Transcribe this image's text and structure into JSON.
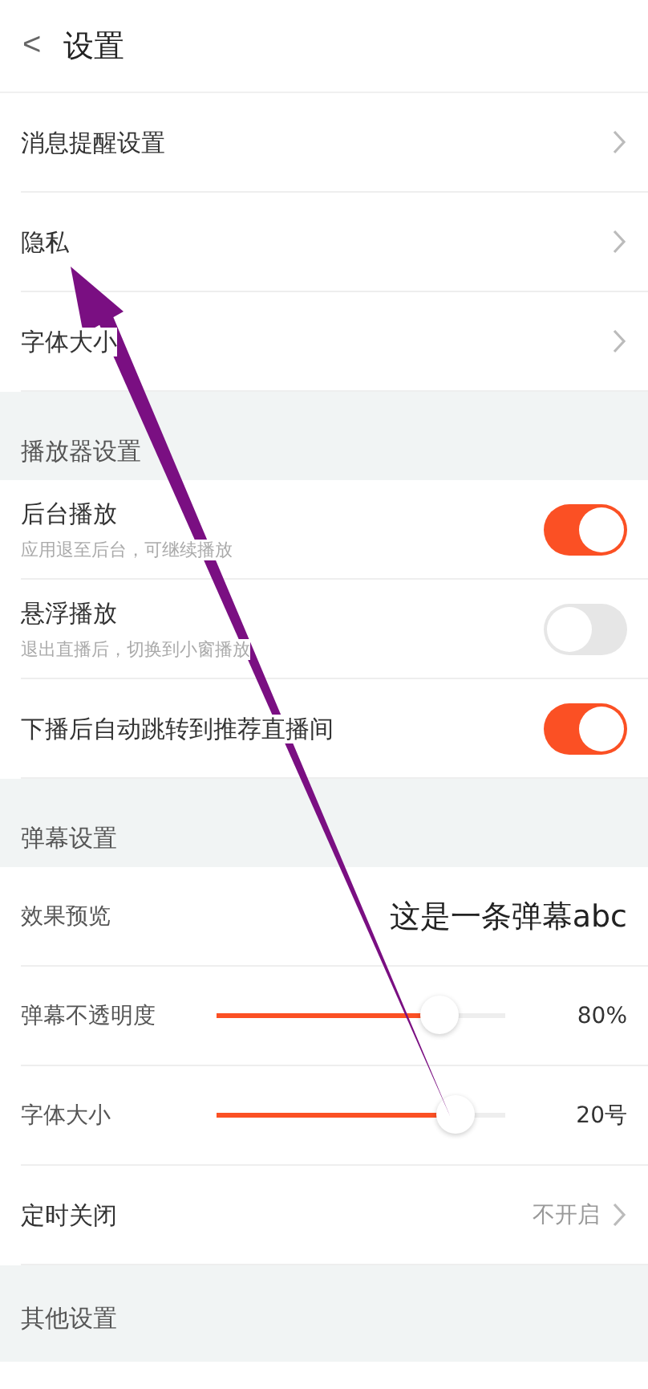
{
  "header": {
    "back": "<",
    "title": "设置"
  },
  "sections": [
    {
      "items": [
        {
          "kind": "link",
          "label": "消息提醒设置",
          "chevron": true
        },
        {
          "kind": "link",
          "label": "隐私",
          "chevron": true
        },
        {
          "kind": "link",
          "label": "字体大小",
          "chevron": true
        }
      ]
    },
    {
      "title": "播放器设置",
      "items": [
        {
          "kind": "toggle",
          "label": "后台播放",
          "subtitle": "应用退至后台，可继续播放",
          "on": true
        },
        {
          "kind": "toggle",
          "label": "悬浮播放",
          "subtitle": "退出直播后，切换到小窗播放",
          "on": false
        },
        {
          "kind": "toggle",
          "label": "下播后自动跳转到推荐直播间",
          "on": true
        }
      ]
    },
    {
      "title": "弹幕设置",
      "items": [
        {
          "kind": "preview",
          "label": "效果预览",
          "value": "这是一条弹幕abc"
        },
        {
          "kind": "slider",
          "label": "弹幕不透明度",
          "level": 0.77,
          "reading": "80%"
        },
        {
          "kind": "slider",
          "label": "字体大小",
          "level": 0.83,
          "reading": "20号"
        },
        {
          "kind": "link",
          "label": "定时关闭",
          "value": "不开启",
          "chevron": true
        }
      ]
    },
    {
      "title": "其他设置"
    }
  ]
}
